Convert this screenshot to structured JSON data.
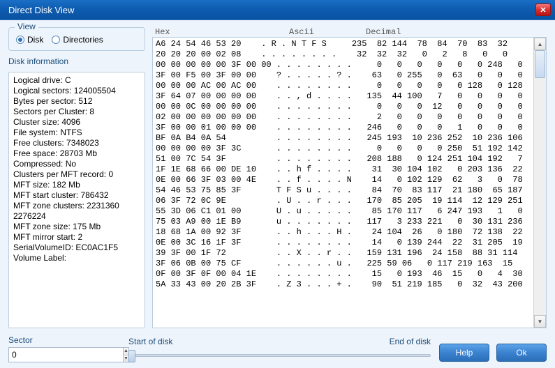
{
  "window": {
    "title": "Direct Disk View"
  },
  "view": {
    "legend": "View",
    "disk_label": "Disk",
    "directories_label": "Directories",
    "selected": "disk"
  },
  "disk_info": {
    "title": "Disk information",
    "lines": [
      "Logical drive: C",
      "Logical sectors: 124005504",
      "Bytes per sector: 512",
      "Sectors per Cluster: 8",
      "Cluster size: 4096",
      "File system: NTFS",
      "Free clusters: 7348023",
      "Free space: 28703 Mb",
      "Compressed: No",
      "Clusters per MFT record: 0",
      "MFT size: 182 Mb",
      "MFT start cluster: 786432",
      "MFT zone clusters: 2231360 2276224",
      "MFT zone size: 175 Mb",
      "MFT mirror start: 2",
      "SerialVolumeID: EC0AC1F5",
      "Volume Label:"
    ]
  },
  "hex": {
    "header_hex": "Hex",
    "header_ascii": "Ascii",
    "header_decimal": "Decimal",
    "rows": [
      "A6 24 54 46 53 20    . R . N T F S     235  82 144  78  84  70  83  32",
      "20 20 20 00 02 08    . . . . . . . .    32  32  32   0   2   8   0   0",
      "00 00 00 00 00 3F 00 00 . . . . . . . .     0   0   0   0   0   0 248   0",
      "3F 00 F5 00 3F 00 00    ? . . . . . ? .    63   0 255   0  63   0   0   0",
      "00 00 00 AC 00 AC 00    . . . . . . . .     0   0   0   0   0 128   0 128",
      "3F 64 07 00 00 00 00    . . , d . . . .   135  44 100   7   0   0   0   0",
      "00 00 0C 00 00 00 00    . . . . . . . .     0   0   0  12   0   0   0   0",
      "02 00 00 00 00 00 00    . . . . . . . .     2   0   0   0   0   0   0   0",
      "3F 00 00 01 00 00 00    . . . . . . . .   246   0   0   0   1   0   0   0",
      "BF 0A B4 0A 54          . . . . . . . .   245 193  10 236 252  10 236 106",
      "00 00 00 00 3F 3C       . . . . . . . .     0   0   0   0 250  51 192 142",
      "51 00 7C 54 3F          . . . . . . . .   208 188   0 124 251 104 192   7",
      "1F 1E 68 66 00 DE 10    . . h f . . . .    31  30 104 102   0 203 136  22",
      "0E 00 66 3F 03 00 4E    . . f . . . . N    14   0 102 129  62   3   0  78",
      "54 46 53 75 85 3F       T F S u . . . .    84  70  83 117  21 180  65 187",
      "06 3F 72 0C 9E          . U . . r . . .   170  85 205  19 114  12 129 251",
      "55 3D 06 C1 01 00       U . u . . . . .    85 170 117   6 247 193   1   0",
      "75 03 A9 00 1E B9       u . . . . . . .   117   3 233 221   0  30 131 236",
      "18 68 1A 00 92 3F       . . h . . . H .    24 104  26   0 180  72 138  22",
      "0E 00 3C 16 1F 3F       . . . . . . . .    14   0 139 244  22  31 205  19",
      "39 3F 00 1F 72          . . X . . r . .   159 131 196  24 158  88 31 114",
      "3F 06 0B 00 75 CF       . . . . . . u .   225 59 06   0 117 219 163  15",
      "0F 00 3F 0F 00 04 1E    . . . . . . . .    15   0 193  46  15   0   4  30",
      "5A 33 43 00 20 2B 3F    . Z 3 . . . + .    90  51 219 185   0  32  43 200"
    ]
  },
  "sector": {
    "label": "Sector",
    "value": "0"
  },
  "slider": {
    "start_label": "Start of disk",
    "end_label": "End of disk"
  },
  "buttons": {
    "help": "Help",
    "ok": "Ok"
  }
}
